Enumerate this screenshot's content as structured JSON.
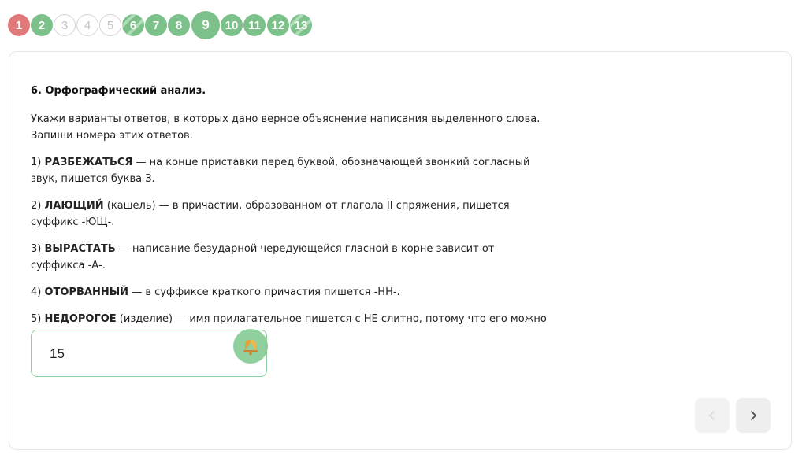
{
  "progress": {
    "steps": [
      {
        "label": "1",
        "state": "wrong"
      },
      {
        "label": "2",
        "state": "correct"
      },
      {
        "label": "3",
        "state": "empty"
      },
      {
        "label": "4",
        "state": "empty"
      },
      {
        "label": "5",
        "state": "empty"
      },
      {
        "label": "6",
        "state": "partial"
      },
      {
        "label": "7",
        "state": "correct"
      },
      {
        "label": "8",
        "state": "correct"
      },
      {
        "label": "9",
        "state": "current"
      },
      {
        "label": "10",
        "state": "correct"
      },
      {
        "label": "11",
        "state": "correct"
      },
      {
        "label": "12",
        "state": "correct"
      },
      {
        "label": "13",
        "state": "partial"
      }
    ]
  },
  "question": {
    "title": "6. Орфографический анализ.",
    "instruction": "Укажи варианты ответов, в которых дано верное объяснение написания выделенного слова. Запиши номера этих ответов.",
    "options": [
      {
        "num": "1)",
        "word": "РАЗБЕЖАТЬСЯ",
        "note": "",
        "text": " — на конце приставки перед буквой, обозначающей звонкий согласный звук, пишется буква З."
      },
      {
        "num": "2)",
        "word": "ЛАЮЩИЙ",
        "note": " (кашель)",
        "text": " — в причастии, образованном от глагола II спряжения, пишется суффикс -ЮЩ-."
      },
      {
        "num": "3)",
        "word": "ВЫРАСТАТЬ",
        "note": "",
        "text": " — написание безударной чередующейся гласной в корне зависит от суффикса -А-."
      },
      {
        "num": "4)",
        "word": "ОТОРВАННЫЙ",
        "note": "",
        "text": " — в суффиксе краткого причастия пишется -НН-."
      },
      {
        "num": "5)",
        "word": "НЕДОРОГОЕ",
        "note": " (изделие)",
        "text": " — имя прилагательное пишется с НЕ слитно, потому что его можно заменить синонимом без НЕ."
      }
    ]
  },
  "answer": {
    "value": "15"
  },
  "colors": {
    "wrong": "#e07a7a",
    "correct": "#7cc08a",
    "empty_border": "#d5d5d5",
    "accent_border": "#8fcf9c"
  },
  "icons": {
    "badge": "bell-icon",
    "prev": "chevron-left-icon",
    "next": "chevron-right-icon"
  }
}
